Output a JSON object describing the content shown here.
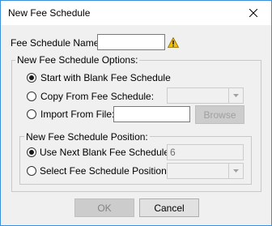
{
  "window": {
    "title": "New Fee Schedule",
    "close_icon": "close-icon"
  },
  "name_row": {
    "label": "Fee Schedule Name:",
    "value": "",
    "warning_icon": "warning-icon",
    "warning_color": "#f2c200"
  },
  "options_group": {
    "title": "New Fee Schedule Options:",
    "options": [
      {
        "label": "Start with Blank Fee Schedule",
        "selected": true
      },
      {
        "label": "Copy From Fee Schedule:",
        "selected": false
      },
      {
        "label": "Import From File:",
        "selected": false
      }
    ],
    "copy_combo_value": "",
    "import_file_value": "",
    "browse_label": "Browse"
  },
  "position_group": {
    "title": "New Fee Schedule Position:",
    "options": [
      {
        "label": "Use Next Blank Fee Schedule:",
        "selected": true
      },
      {
        "label": "Select Fee Schedule Position:",
        "selected": false
      }
    ],
    "next_blank_value": "6",
    "position_combo_value": ""
  },
  "buttons": {
    "ok_label": "OK",
    "cancel_label": "Cancel"
  }
}
